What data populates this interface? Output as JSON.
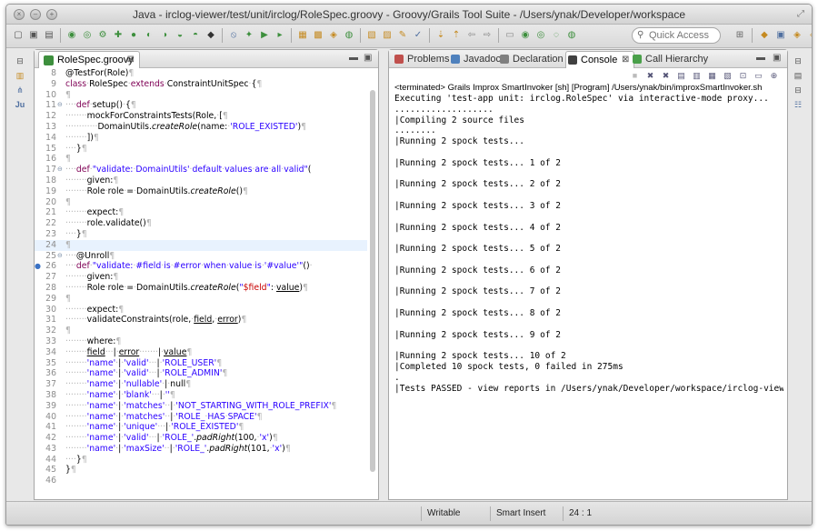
{
  "window": {
    "title": "Java - irclog-viewer/test/unit/irclog/RoleSpec.groovy - Groovy/Grails Tool Suite - /Users/ynak/Developer/workspace"
  },
  "toolbar": {
    "quick_access_placeholder": "Quick Access"
  },
  "editor": {
    "tab_label": "RoleSpec.groovy",
    "lines": [
      {
        "n": "8",
        "html": "@TestFor(Role)<span class=\"ws\">¶</span>"
      },
      {
        "n": "9",
        "html": "<span class=\"kw\">class</span><span class=\"ws\">·</span>RoleSpec<span class=\"ws\">·</span><span class=\"kw\">extends</span><span class=\"ws\">·</span>ConstraintUnitSpec<span class=\"ws\">·</span>{<span class=\"ws\">¶</span>"
      },
      {
        "n": "10",
        "html": "<span class=\"ws\">¶</span>"
      },
      {
        "n": "11",
        "fold": true,
        "html": "<span class=\"ws\">····</span><span class=\"kw\">def</span><span class=\"ws\">·</span>setup()<span class=\"ws\">·</span>{<span class=\"ws\">¶</span>"
      },
      {
        "n": "12",
        "html": "<span class=\"ws\">········</span>mockForConstraintsTests(Role,<span class=\"ws\">·</span>[<span class=\"ws\">¶</span>"
      },
      {
        "n": "13",
        "html": "<span class=\"ws\">············</span>DomainUtils.<span class=\"it\">createRole</span>(name:<span class=\"ws\">·</span><span class=\"str\">'ROLE_EXISTED'</span>)<span class=\"ws\">¶</span>"
      },
      {
        "n": "14",
        "html": "<span class=\"ws\">········</span>])<span class=\"ws\">¶</span>"
      },
      {
        "n": "15",
        "html": "<span class=\"ws\">····</span>}<span class=\"ws\">¶</span>"
      },
      {
        "n": "16",
        "html": "<span class=\"ws\">¶</span>"
      },
      {
        "n": "17",
        "fold": true,
        "html": "<span class=\"ws\">····</span><span class=\"kw\">def</span><span class=\"ws\">·</span><span class=\"str\">\"validate:<span class=\"ws\">·</span>DomainUtils'<span class=\"ws\">·</span>default<span class=\"ws\">·</span>values<span class=\"ws\">·</span>are<span class=\"ws\">·</span>all<span class=\"ws\">·</span>valid\"</span>("
      },
      {
        "n": "18",
        "html": "<span class=\"ws\">········</span>given:<span class=\"ws\">¶</span>"
      },
      {
        "n": "19",
        "html": "<span class=\"ws\">········</span>Role<span class=\"ws\">·</span>role<span class=\"ws\">·</span>=<span class=\"ws\">·</span>DomainUtils.<span class=\"it\">createRole</span>()<span class=\"ws\">¶</span>"
      },
      {
        "n": "20",
        "html": "<span class=\"ws\">¶</span>"
      },
      {
        "n": "21",
        "html": "<span class=\"ws\">········</span>expect:<span class=\"ws\">¶</span>"
      },
      {
        "n": "22",
        "html": "<span class=\"ws\">········</span>role.validate()<span class=\"ws\">¶</span>"
      },
      {
        "n": "23",
        "html": "<span class=\"ws\">····</span>}<span class=\"ws\">¶</span>"
      },
      {
        "n": "24",
        "hl": true,
        "html": "<span class=\"ws\">¶</span>"
      },
      {
        "n": "25",
        "fold": true,
        "html": "<span class=\"ws\">····</span>@Unroll<span class=\"ws\">¶</span>"
      },
      {
        "n": "26",
        "mark": true,
        "html": "<span class=\"ws\">····</span><span class=\"kw\">def</span><span class=\"ws\">·</span><span class=\"str\">\"validate:<span class=\"ws\">·</span>#field<span class=\"ws\">·</span>is<span class=\"ws\">·</span>#error<span class=\"ws\">·</span>when<span class=\"ws\">·</span>value<span class=\"ws\">·</span>is<span class=\"ws\">·</span>'#value'\"</span>()<span class=\"ws\">·</span>"
      },
      {
        "n": "27",
        "html": "<span class=\"ws\">········</span>given:<span class=\"ws\">¶</span>"
      },
      {
        "n": "28",
        "html": "<span class=\"ws\">········</span>Role<span class=\"ws\">·</span>role<span class=\"ws\">·</span>=<span class=\"ws\">·</span>DomainUtils.<span class=\"it\">createRole</span>(<span class=\"str\">\"<span class=\"interp\">$field</span>\"</span>:<span class=\"ws\">·</span><span class=\"ul\">value</span>)<span class=\"ws\">¶</span>"
      },
      {
        "n": "29",
        "html": "<span class=\"ws\">¶</span>"
      },
      {
        "n": "30",
        "html": "<span class=\"ws\">········</span>expect:<span class=\"ws\">¶</span>"
      },
      {
        "n": "31",
        "html": "<span class=\"ws\">········</span>validateConstraints(role,<span class=\"ws\">·</span><span class=\"ul\">field</span>,<span class=\"ws\">·</span><span class=\"ul\">error</span>)<span class=\"ws\">¶</span>"
      },
      {
        "n": "32",
        "html": "<span class=\"ws\">¶</span>"
      },
      {
        "n": "33",
        "html": "<span class=\"ws\">········</span>where:<span class=\"ws\">¶</span>"
      },
      {
        "n": "34",
        "html": "<span class=\"ws\">········</span><span class=\"ul\">field</span><span class=\"ws\">···</span>|<span class=\"ws\">·</span><span class=\"ul\">error</span><span class=\"ws\">·······</span>|<span class=\"ws\">·</span><span class=\"ul\">value</span><span class=\"ws\">¶</span>"
      },
      {
        "n": "35",
        "html": "<span class=\"ws\">········</span><span class=\"str\">'name'</span><span class=\"ws\">·</span>|<span class=\"ws\">·</span><span class=\"str\">'valid'</span><span class=\"ws\">···</span>|<span class=\"ws\">·</span><span class=\"str\">'ROLE_USER'</span><span class=\"ws\">¶</span>"
      },
      {
        "n": "36",
        "html": "<span class=\"ws\">········</span><span class=\"str\">'name'</span><span class=\"ws\">·</span>|<span class=\"ws\">·</span><span class=\"str\">'valid'</span><span class=\"ws\">···</span>|<span class=\"ws\">·</span><span class=\"str\">'ROLE_ADMIN'</span><span class=\"ws\">¶</span>"
      },
      {
        "n": "37",
        "html": "<span class=\"ws\">········</span><span class=\"str\">'name'</span><span class=\"ws\">·</span>|<span class=\"ws\">·</span><span class=\"str\">'nullable'</span><span class=\"ws\">·</span>|<span class=\"ws\">·</span>null<span class=\"ws\">¶</span>"
      },
      {
        "n": "38",
        "html": "<span class=\"ws\">········</span><span class=\"str\">'name'</span><span class=\"ws\">·</span>|<span class=\"ws\">·</span><span class=\"str\">'blank'</span><span class=\"ws\">···</span>|<span class=\"ws\">·</span><span class=\"str\">''</span><span class=\"ws\">¶</span>"
      },
      {
        "n": "39",
        "html": "<span class=\"ws\">········</span><span class=\"str\">'name'</span><span class=\"ws\">·</span>|<span class=\"ws\">·</span><span class=\"str\">'matches'</span><span class=\"ws\">··</span>|<span class=\"ws\">·</span><span class=\"str\">'NOT_STARTING_WITH_ROLE_PREFIX'</span><span class=\"ws\">¶</span>"
      },
      {
        "n": "40",
        "html": "<span class=\"ws\">········</span><span class=\"str\">'name'</span><span class=\"ws\">·</span>|<span class=\"ws\">·</span><span class=\"str\">'matches'</span><span class=\"ws\">··</span>|<span class=\"ws\">·</span><span class=\"str\">'ROLE_<span class=\"ws\">·</span>HAS<span class=\"ws\">·</span>SPACE'</span><span class=\"ws\">¶</span>"
      },
      {
        "n": "41",
        "html": "<span class=\"ws\">········</span><span class=\"str\">'name'</span><span class=\"ws\">·</span>|<span class=\"ws\">·</span><span class=\"str\">'unique'</span><span class=\"ws\">···</span>|<span class=\"ws\">·</span><span class=\"str\">'ROLE_EXISTED'</span><span class=\"ws\">¶</span>"
      },
      {
        "n": "42",
        "html": "<span class=\"ws\">········</span><span class=\"str\">'name'</span><span class=\"ws\">·</span>|<span class=\"ws\">·</span><span class=\"str\">'valid'</span><span class=\"ws\">···</span>|<span class=\"ws\">·</span><span class=\"str\">'ROLE_'</span>.<span class=\"it\">padRight</span>(100,<span class=\"ws\">·</span><span class=\"str\">'x'</span>)<span class=\"ws\">¶</span>"
      },
      {
        "n": "43",
        "html": "<span class=\"ws\">········</span><span class=\"str\">'name'</span><span class=\"ws\">·</span>|<span class=\"ws\">·</span><span class=\"str\">'maxSize'</span><span class=\"ws\">··</span>|<span class=\"ws\">·</span><span class=\"str\">'ROLE_'</span>.<span class=\"it\">padRight</span>(101,<span class=\"ws\">·</span><span class=\"str\">'x'</span>)<span class=\"ws\">¶</span>"
      },
      {
        "n": "44",
        "html": "<span class=\"ws\">····</span>}<span class=\"ws\">¶</span>"
      },
      {
        "n": "45",
        "html": "}<span class=\"ws\">¶</span>"
      },
      {
        "n": "46",
        "html": ""
      }
    ]
  },
  "console": {
    "tabs": [
      {
        "label": "Problems",
        "color": "#c0504d"
      },
      {
        "label": "Javadoc",
        "color": "#4f81bd"
      },
      {
        "label": "Declaration",
        "color": "#7f7f7f"
      },
      {
        "label": "Console",
        "color": "#404040",
        "active": true
      },
      {
        "label": "Call Hierarchy",
        "color": "#4aa04a"
      }
    ],
    "terminated_text": "<terminated> Grails Improx SmartInvoker [sh] [Program] /Users/ynak/bin/improxSmartInvoker.sh",
    "output": [
      "Executing 'test-app unit: irclog.RoleSpec' via interactive-mode proxy...",
      "...................",
      "|Compiling 2 source files",
      "........",
      "|Running 2 spock tests...",
      "",
      "|Running 2 spock tests... 1 of 2",
      "",
      "|Running 2 spock tests... 2 of 2",
      "",
      "|Running 2 spock tests... 3 of 2",
      "",
      "|Running 2 spock tests... 4 of 2",
      "",
      "|Running 2 spock tests... 5 of 2",
      "",
      "|Running 2 spock tests... 6 of 2",
      "",
      "|Running 2 spock tests... 7 of 2",
      "",
      "|Running 2 spock tests... 8 of 2",
      "",
      "|Running 2 spock tests... 9 of 2",
      "",
      "|Running 2 spock tests... 10 of 2",
      "|Completed 10 spock tests, 0 failed in 275ms",
      ".",
      "|Tests PASSED - view reports in /Users/ynak/Developer/workspace/irclog-viewer/ta"
    ]
  },
  "status": {
    "writable": "Writable",
    "insert_mode": "Smart Insert",
    "position": "24 : 1"
  }
}
